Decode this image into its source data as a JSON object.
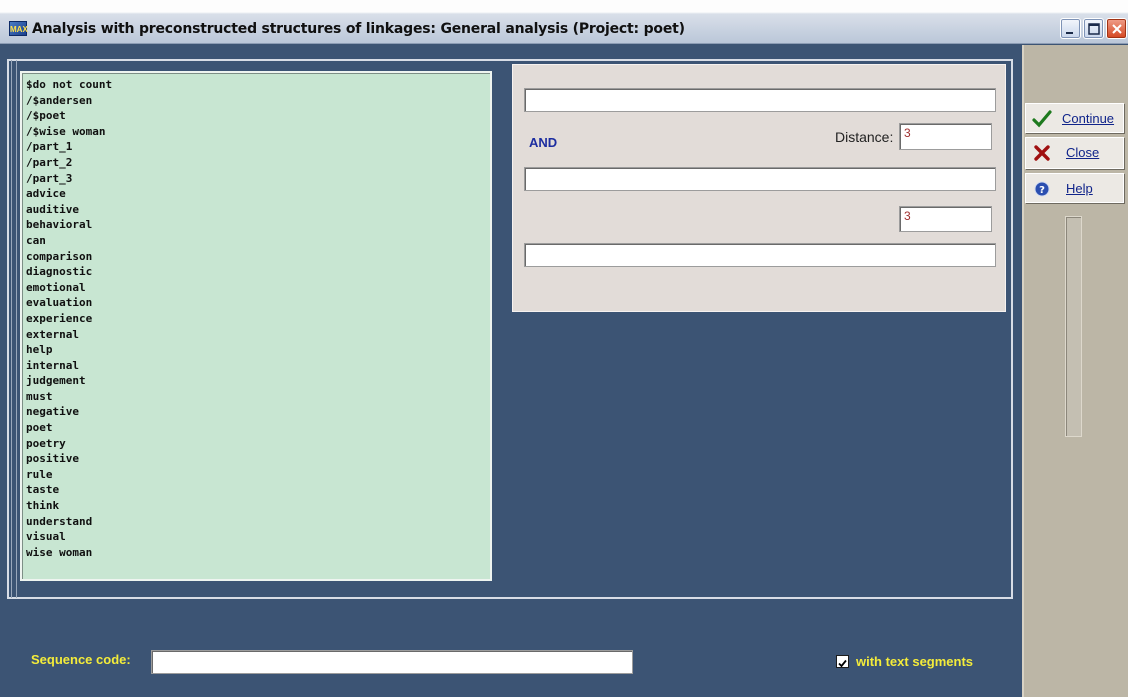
{
  "window": {
    "title": "Analysis with preconstructed structures of linkages: General analysis (Project: poet)",
    "icon_text": "MAX"
  },
  "word_list": [
    "$do not count",
    "/$andersen",
    "/$poet",
    "/$wise woman",
    "/part_1",
    "/part_2",
    "/part_3",
    "advice",
    "auditive",
    "behavioral",
    "can",
    "comparison",
    "diagnostic",
    "emotional",
    "evaluation",
    "experience",
    "external",
    "help",
    "internal",
    "judgement",
    "must",
    "negative",
    "poet",
    "poetry",
    "positive",
    "rule",
    "taste",
    "think",
    "understand",
    "visual",
    "wise woman"
  ],
  "criteria": {
    "field1_value": "",
    "operator_label": "AND",
    "distance_label": "Distance:",
    "distance1_value": "3",
    "field2_value": "",
    "distance2_value": "3",
    "field3_value": ""
  },
  "buttons": {
    "continue_label": "Continue",
    "close_label": "Close",
    "help_label": "Help"
  },
  "footer": {
    "sequence_label": "Sequence code:",
    "sequence_value": "",
    "with_segments_label": "with text segments",
    "with_segments_checked": true
  },
  "colors": {
    "background": "#3c5474",
    "list_background": "#c8e6d2",
    "label_yellow": "#f4ec3a",
    "and_blue": "#1c2da0"
  }
}
